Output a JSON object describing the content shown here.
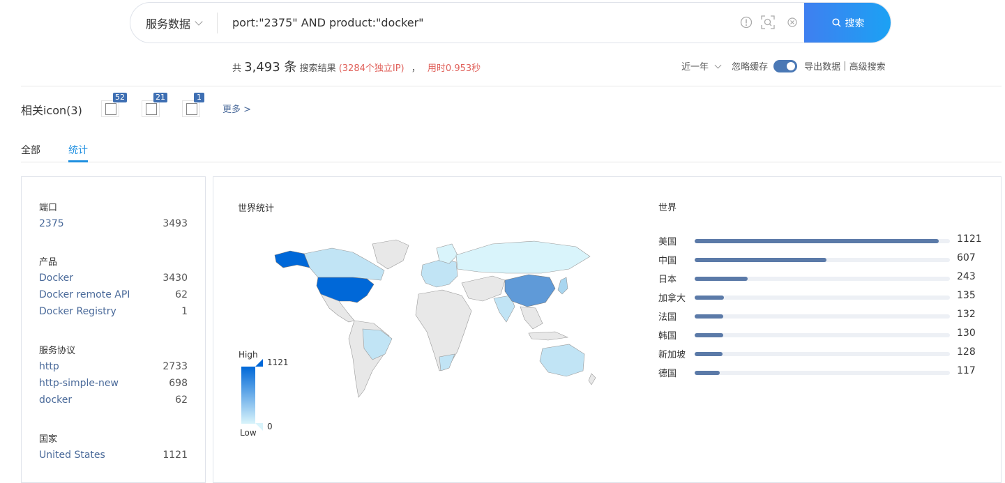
{
  "search": {
    "type_label": "服务数据",
    "query": "port:\"2375\" AND product:\"docker\"",
    "button_label": "搜索"
  },
  "summary": {
    "prefix": "共",
    "count": "3,493 条",
    "result_text": "搜索结果",
    "unique_ip": "(3284个独立IP)",
    "comma": "，",
    "time": "用时0.953秒",
    "range": "近一年",
    "ignore_cache": "忽略缓存",
    "export": "导出数据",
    "sep": "|",
    "advanced": "高级搜索"
  },
  "icons": {
    "title": "相关icon(3)",
    "badges": [
      "52",
      "21",
      "1"
    ],
    "more": "更多 >"
  },
  "tabs": [
    "全部",
    "统计"
  ],
  "left_panel": {
    "groups": [
      {
        "title": "端口",
        "rows": [
          {
            "name": "2375",
            "count": "3493"
          }
        ]
      },
      {
        "title": "产品",
        "rows": [
          {
            "name": "Docker",
            "count": "3430"
          },
          {
            "name": "Docker remote API",
            "count": "62"
          },
          {
            "name": "Docker Registry",
            "count": "1"
          }
        ]
      },
      {
        "title": "服务协议",
        "rows": [
          {
            "name": "http",
            "count": "2733"
          },
          {
            "name": "http-simple-new",
            "count": "698"
          },
          {
            "name": "docker",
            "count": "62"
          }
        ]
      },
      {
        "title": "国家",
        "rows": [
          {
            "name": "United States",
            "count": "1121"
          }
        ]
      }
    ]
  },
  "map": {
    "title": "世界统计",
    "legend_high": "High",
    "legend_low": "Low",
    "legend_max": "1121",
    "legend_min": "0"
  },
  "colors": {
    "accent": "#1e8fe0",
    "bar": "#5b7aa8",
    "map_high": "#0068d8",
    "map_low": "#d9f4fb"
  },
  "world": {
    "title": "世界",
    "max": 1121,
    "items": [
      {
        "label": "美国",
        "value": 1121
      },
      {
        "label": "中国",
        "value": 607
      },
      {
        "label": "日本",
        "value": 243
      },
      {
        "label": "加拿大",
        "value": 135
      },
      {
        "label": "法国",
        "value": 132
      },
      {
        "label": "韩国",
        "value": 130
      },
      {
        "label": "新加坡",
        "value": 128
      },
      {
        "label": "德国",
        "value": 117
      }
    ]
  }
}
